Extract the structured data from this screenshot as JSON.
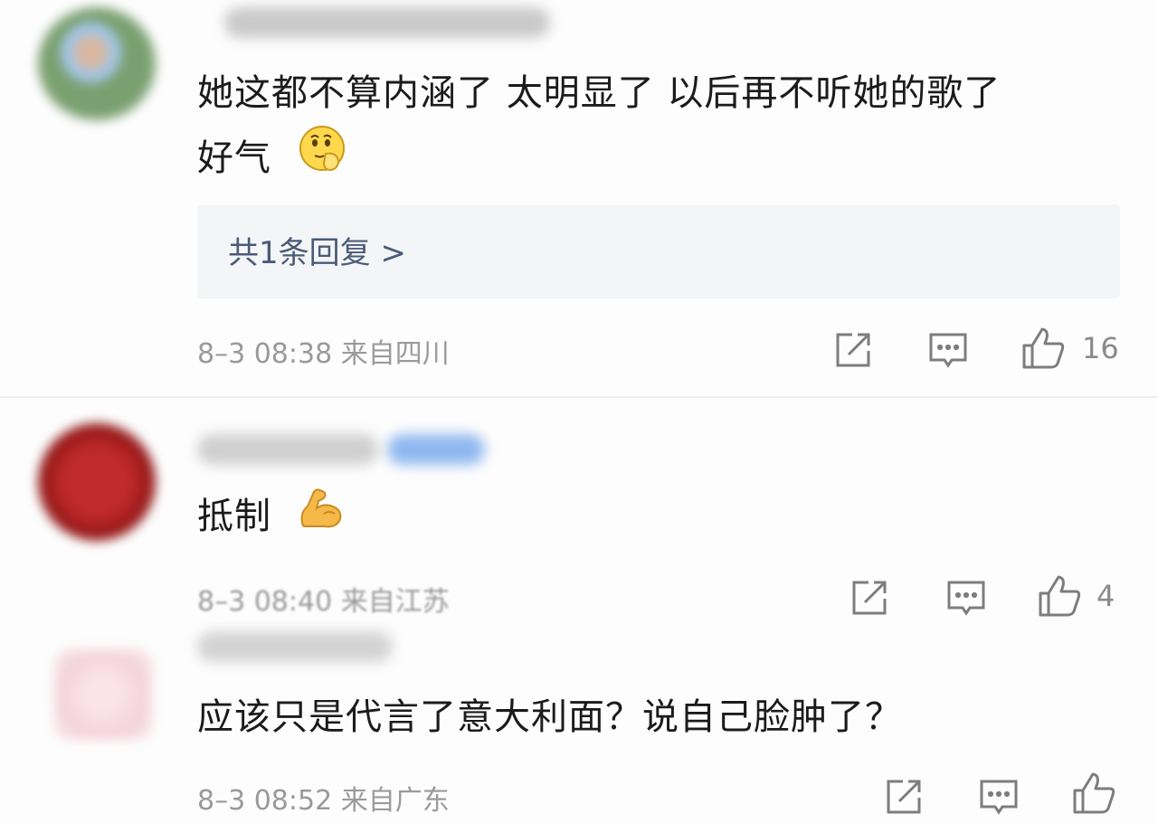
{
  "comments": [
    {
      "text_line1": "她这都不算内涵了 太明显了 以后再不听她的歌了",
      "text_line2": "好气",
      "emoji_icon": "thinking-emoji-icon",
      "replies_label": "共1条回复 >",
      "meta": "8–3 08:38 来自四川",
      "likes": "16",
      "avatar_color": "#7aa070"
    },
    {
      "text_line1": "抵制",
      "emoji_icon": "flexed-biceps-emoji-icon",
      "meta": "8–3 08:40 来自江苏",
      "likes": "4",
      "avatar_color": "#a51d1d",
      "badge_color": "#8fb8f0"
    },
    {
      "text_line1": "应该只是代言了意大利面？说自己脸肿了？",
      "meta": "8–3 08:52 来自广东",
      "likes": "",
      "avatar_color": "#f3d3da"
    }
  ],
  "colors": {
    "reply_link": "#4a5b78",
    "meta_text": "#9a9a9a",
    "icon_stroke": "#7d7d7d"
  }
}
